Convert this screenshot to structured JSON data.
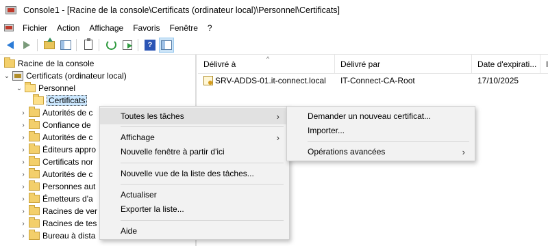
{
  "window": {
    "title": "Console1 - [Racine de la console\\Certificats (ordinateur local)\\Personnel\\Certificats]"
  },
  "menubar": {
    "items": [
      "Fichier",
      "Action",
      "Affichage",
      "Favoris",
      "Fenêtre",
      "?"
    ]
  },
  "toolbar": {
    "buttons": [
      "back-icon",
      "forward-icon",
      "up-folder-icon",
      "show-hide-tree-icon",
      "properties-icon",
      "refresh-icon",
      "export-list-icon",
      "help-icon",
      "show-hide-action-pane-icon"
    ]
  },
  "tree": {
    "root": "Racine de la console",
    "store": "Certificats (ordinateur local)",
    "personal": "Personnel",
    "certificates": "Certificats",
    "children": [
      "Autorités de c",
      "Confiance de",
      "Autorités de c",
      "Éditeurs appro",
      "Certificats nor",
      "Autorités de c",
      "Personnes aut",
      "Émetteurs d'a",
      "Racines de ver",
      "Racines de tes",
      "Bureau à dista"
    ]
  },
  "list": {
    "columns": [
      "Délivré à",
      "Délivré par",
      "Date d'expirati...",
      "I"
    ],
    "rows": [
      {
        "issued_to": "SRV-ADDS-01.it-connect.local",
        "issued_by": "IT-Connect-CA-Root",
        "expiration": "17/10/2025"
      }
    ]
  },
  "context_menu": {
    "items": [
      {
        "label": "Toutes les tâches",
        "submenu": true,
        "highlighted": true
      },
      {
        "label": "Affichage",
        "submenu": true
      },
      {
        "label": "Nouvelle fenêtre à partir d'ici"
      },
      {
        "label": "Nouvelle vue de la liste des tâches..."
      },
      {
        "label": "Actualiser"
      },
      {
        "label": "Exporter la liste..."
      },
      {
        "label": "Aide"
      }
    ]
  },
  "submenu": {
    "items": [
      {
        "label": "Demander un nouveau certificat..."
      },
      {
        "label": "Importer..."
      },
      {
        "label": "Opérations avancées",
        "submenu": true
      }
    ]
  },
  "glyphs": {
    "submenu_arrow": "›",
    "expanded": "⌄",
    "collapsed": "›",
    "help": "?"
  }
}
